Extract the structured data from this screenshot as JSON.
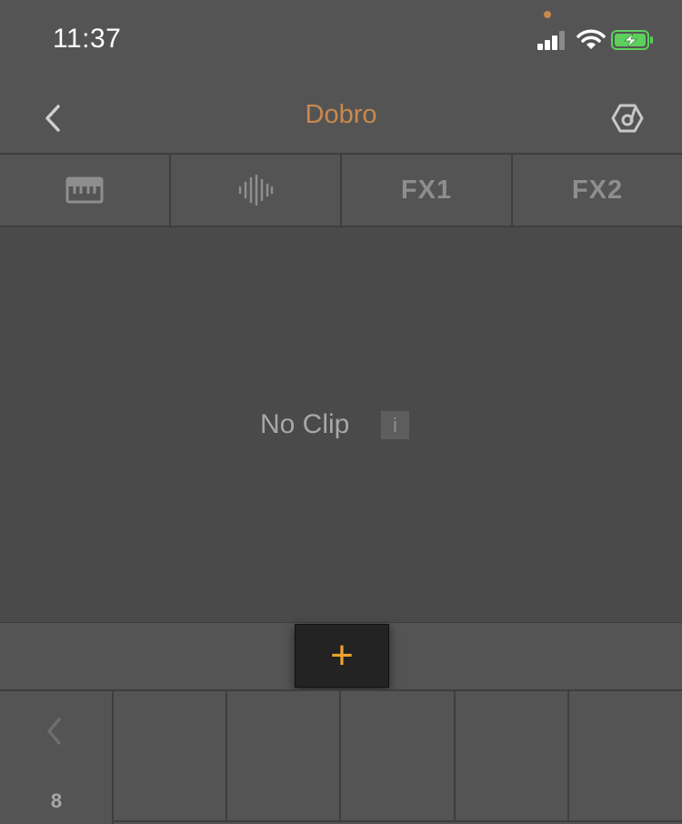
{
  "status_bar": {
    "time": "11:37",
    "icons": [
      "recording-dot-icon",
      "cellular-signal-icon",
      "wifi-icon",
      "battery-charging-icon"
    ],
    "accent": "#c9894d",
    "battery_color": "#5cd05c"
  },
  "nav": {
    "title": "Dobro",
    "back_icon": "chevron-left-icon",
    "right_icon": "device-icon",
    "title_color": "#c9894d"
  },
  "tabs": [
    {
      "label": "",
      "icon": "piano-roll-icon"
    },
    {
      "label": "",
      "icon": "waveform-icon"
    },
    {
      "label": "FX1",
      "icon": ""
    },
    {
      "label": "FX2",
      "icon": ""
    }
  ],
  "clip_area": {
    "empty_label": "No Clip",
    "info_label": "i"
  },
  "add_button": {
    "label": "+",
    "color": "#f0a32d"
  },
  "scene_nav": {
    "back_icon": "chevron-left-icon",
    "scene_number": "8"
  }
}
